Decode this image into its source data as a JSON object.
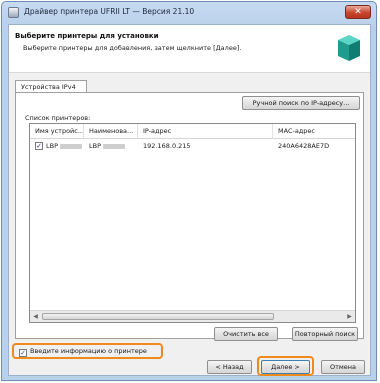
{
  "window": {
    "title": "Драйвер принтера UFRII LT — Версия 21.10",
    "close_glyph": "✕"
  },
  "header": {
    "heading": "Выберите принтеры для установки",
    "instruction": "Выберите принтеры для добавления, затем щелкните [Далее]."
  },
  "tabs": [
    {
      "label": "Устройства IPv4"
    }
  ],
  "buttons": {
    "manual_search": "Ручной поиск по IP-адресу...",
    "clear_all": "Очистить все",
    "repeat_search": "Повторный поиск",
    "back": "< Назад",
    "next": "Далее >",
    "cancel": "Отмена"
  },
  "printer_list": {
    "label": "Список принтеров:",
    "columns": [
      "Имя устройс...",
      "Наименова...",
      "IP-адрес",
      "MAC-адрес"
    ],
    "rows": [
      {
        "checked": true,
        "device_name": "LBP",
        "product_name": "LBP",
        "ip": "192.168.0.215",
        "mac": "240A6428AE7D"
      }
    ]
  },
  "enter_info": {
    "label": "Введите информацию о принтере",
    "checked": true
  },
  "colors": {
    "highlight": "#f08a1c",
    "window_border": "#6d8fb7"
  }
}
